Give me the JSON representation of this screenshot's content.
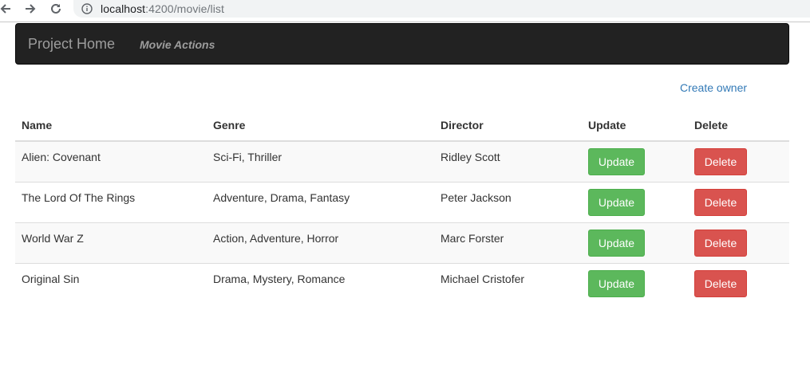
{
  "browser": {
    "url_host": "localhost",
    "url_rest": ":4200/movie/list",
    "icons": {
      "back": "back-arrow-icon",
      "forward": "forward-arrow-icon",
      "reload": "reload-icon",
      "info": "info-icon"
    }
  },
  "navbar": {
    "brand": "Project Home",
    "link": "Movie Actions"
  },
  "actions": {
    "create_link": "Create owner"
  },
  "table": {
    "headers": [
      "Name",
      "Genre",
      "Director",
      "Update",
      "Delete"
    ],
    "rows": [
      {
        "name": "Alien: Covenant",
        "genre": "Sci-Fi, Thriller",
        "director": "Ridley Scott",
        "update": "Update",
        "delete": "Delete"
      },
      {
        "name": "The Lord Of The Rings",
        "genre": "Adventure, Drama, Fantasy",
        "director": "Peter Jackson",
        "update": "Update",
        "delete": "Delete"
      },
      {
        "name": "World War Z",
        "genre": "Action, Adventure, Horror",
        "director": "Marc Forster",
        "update": "Update",
        "delete": "Delete"
      },
      {
        "name": "Original Sin",
        "genre": "Drama, Mystery, Romance",
        "director": "Michael Cristofer",
        "update": "Update",
        "delete": "Delete"
      }
    ]
  },
  "colors": {
    "navbar_bg": "#222222",
    "link": "#337ab7",
    "update_button": "#5cb85c",
    "delete_button": "#d9534f"
  }
}
